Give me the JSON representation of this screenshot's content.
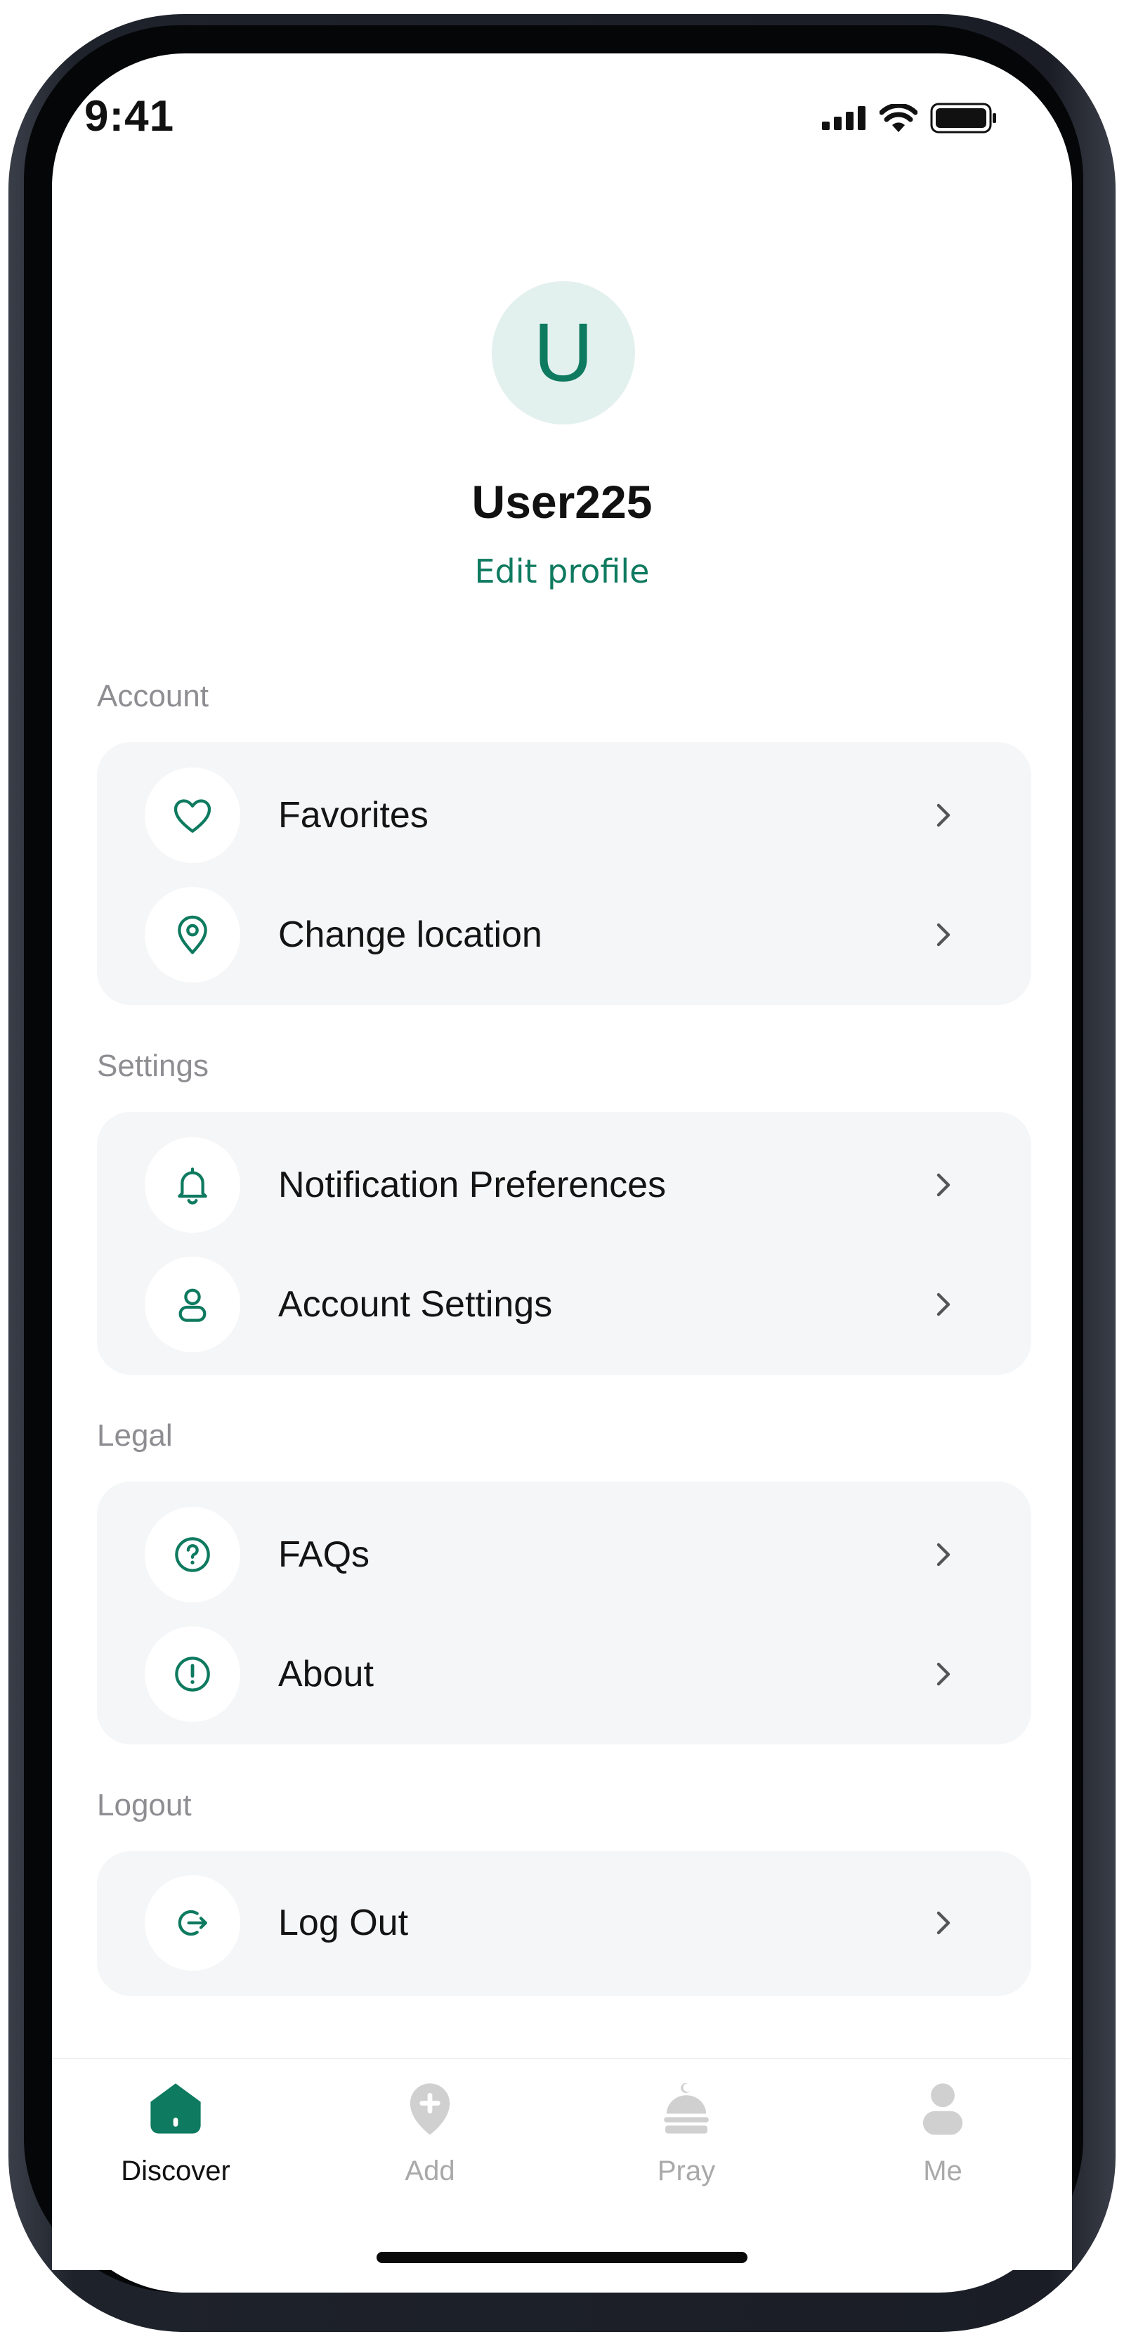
{
  "status_bar": {
    "time": "9:41"
  },
  "profile": {
    "initial": "U",
    "username": "User225",
    "edit_label": "Edit profile"
  },
  "sections": [
    {
      "label": "Account",
      "items": [
        {
          "label": "Favorites",
          "icon": "heart-icon"
        },
        {
          "label": "Change location",
          "icon": "location-pin-icon"
        }
      ]
    },
    {
      "label": "Settings",
      "items": [
        {
          "label": "Notification Preferences",
          "icon": "bell-icon"
        },
        {
          "label": "Account Settings",
          "icon": "user-icon"
        }
      ]
    },
    {
      "label": "Legal",
      "items": [
        {
          "label": "FAQs",
          "icon": "question-icon"
        },
        {
          "label": "About",
          "icon": "info-icon"
        }
      ]
    },
    {
      "label": "Logout",
      "items": [
        {
          "label": "Log Out",
          "icon": "logout-icon"
        }
      ]
    }
  ],
  "tabbar": {
    "active": "Discover",
    "tabs": [
      {
        "label": "Discover",
        "icon": "home-icon"
      },
      {
        "label": "Add",
        "icon": "add-icon"
      },
      {
        "label": "Pray",
        "icon": "mosque-icon"
      },
      {
        "label": "Me",
        "icon": "person-icon"
      }
    ]
  },
  "colors": {
    "accent": "#0e7a5f",
    "avatar_bg": "#e3f1ee",
    "card_bg": "#f5f6f7",
    "muted": "#8d8d92",
    "inactive_tab": "#c4c4c4"
  }
}
